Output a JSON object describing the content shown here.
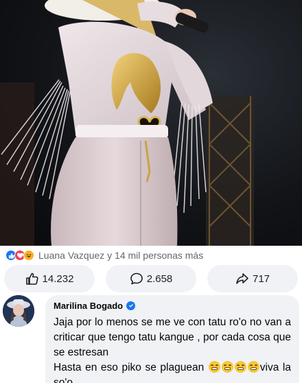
{
  "post": {
    "reactions": {
      "types": [
        "like-icon",
        "love-icon",
        "haha-icon"
      ],
      "summary": "Luana Vazquez y 14 mil personas más"
    },
    "actions": {
      "like_count": "14.232",
      "comment_count": "2.658",
      "share_count": "717"
    }
  },
  "comment": {
    "author": "Marilina Bogado",
    "verified": true,
    "line1": "Jaja por lo menos se me ve con tatu ro'o no van a criticar que tengo tatu kangue , por cada cosa que se estresan",
    "line2_start": "Hasta en eso piko se plaguean",
    "line2_end": "viva la so'o",
    "emoji": "grinning-squinting-face-emoji"
  },
  "colors": {
    "facebook_blue": "#1877f2",
    "love_red": "#f33e58",
    "haha_yellow": "#f7b125",
    "button_bg": "#f0f2f5",
    "muted_text": "#65676b"
  }
}
